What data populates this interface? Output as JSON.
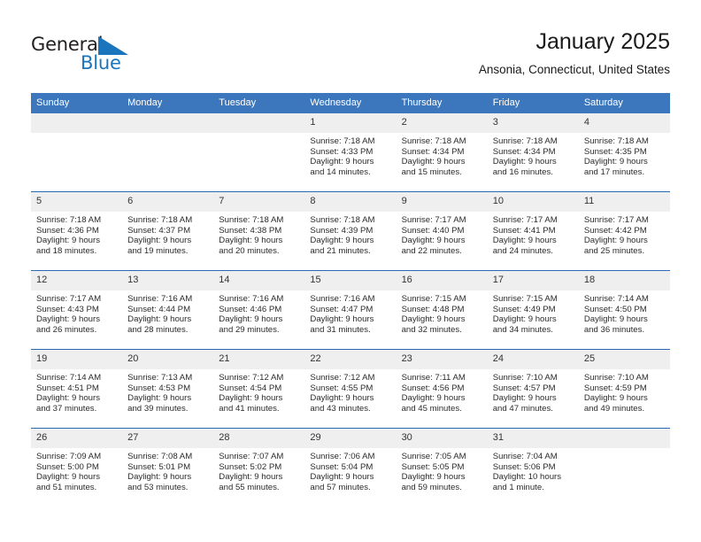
{
  "logo": {
    "word_one": "General",
    "word_two": "Blue",
    "triangle_color": "#1b75bc",
    "text_color": "#231f20"
  },
  "header": {
    "title": "January 2025",
    "subtitle": "Ansonia, Connecticut, United States"
  },
  "theme": {
    "header_blue": "#3c77bd",
    "row_divider_blue": "#2a6ab0",
    "daynum_background": "#efefef"
  },
  "weekday_headers": [
    "Sunday",
    "Monday",
    "Tuesday",
    "Wednesday",
    "Thursday",
    "Friday",
    "Saturday"
  ],
  "weeks": [
    [
      {
        "day": "",
        "lines": []
      },
      {
        "day": "",
        "lines": []
      },
      {
        "day": "",
        "lines": []
      },
      {
        "day": "1",
        "lines": [
          "Sunrise: 7:18 AM",
          "Sunset: 4:33 PM",
          "Daylight: 9 hours",
          "and 14 minutes."
        ]
      },
      {
        "day": "2",
        "lines": [
          "Sunrise: 7:18 AM",
          "Sunset: 4:34 PM",
          "Daylight: 9 hours",
          "and 15 minutes."
        ]
      },
      {
        "day": "3",
        "lines": [
          "Sunrise: 7:18 AM",
          "Sunset: 4:34 PM",
          "Daylight: 9 hours",
          "and 16 minutes."
        ]
      },
      {
        "day": "4",
        "lines": [
          "Sunrise: 7:18 AM",
          "Sunset: 4:35 PM",
          "Daylight: 9 hours",
          "and 17 minutes."
        ]
      }
    ],
    [
      {
        "day": "5",
        "lines": [
          "Sunrise: 7:18 AM",
          "Sunset: 4:36 PM",
          "Daylight: 9 hours",
          "and 18 minutes."
        ]
      },
      {
        "day": "6",
        "lines": [
          "Sunrise: 7:18 AM",
          "Sunset: 4:37 PM",
          "Daylight: 9 hours",
          "and 19 minutes."
        ]
      },
      {
        "day": "7",
        "lines": [
          "Sunrise: 7:18 AM",
          "Sunset: 4:38 PM",
          "Daylight: 9 hours",
          "and 20 minutes."
        ]
      },
      {
        "day": "8",
        "lines": [
          "Sunrise: 7:18 AM",
          "Sunset: 4:39 PM",
          "Daylight: 9 hours",
          "and 21 minutes."
        ]
      },
      {
        "day": "9",
        "lines": [
          "Sunrise: 7:17 AM",
          "Sunset: 4:40 PM",
          "Daylight: 9 hours",
          "and 22 minutes."
        ]
      },
      {
        "day": "10",
        "lines": [
          "Sunrise: 7:17 AM",
          "Sunset: 4:41 PM",
          "Daylight: 9 hours",
          "and 24 minutes."
        ]
      },
      {
        "day": "11",
        "lines": [
          "Sunrise: 7:17 AM",
          "Sunset: 4:42 PM",
          "Daylight: 9 hours",
          "and 25 minutes."
        ]
      }
    ],
    [
      {
        "day": "12",
        "lines": [
          "Sunrise: 7:17 AM",
          "Sunset: 4:43 PM",
          "Daylight: 9 hours",
          "and 26 minutes."
        ]
      },
      {
        "day": "13",
        "lines": [
          "Sunrise: 7:16 AM",
          "Sunset: 4:44 PM",
          "Daylight: 9 hours",
          "and 28 minutes."
        ]
      },
      {
        "day": "14",
        "lines": [
          "Sunrise: 7:16 AM",
          "Sunset: 4:46 PM",
          "Daylight: 9 hours",
          "and 29 minutes."
        ]
      },
      {
        "day": "15",
        "lines": [
          "Sunrise: 7:16 AM",
          "Sunset: 4:47 PM",
          "Daylight: 9 hours",
          "and 31 minutes."
        ]
      },
      {
        "day": "16",
        "lines": [
          "Sunrise: 7:15 AM",
          "Sunset: 4:48 PM",
          "Daylight: 9 hours",
          "and 32 minutes."
        ]
      },
      {
        "day": "17",
        "lines": [
          "Sunrise: 7:15 AM",
          "Sunset: 4:49 PM",
          "Daylight: 9 hours",
          "and 34 minutes."
        ]
      },
      {
        "day": "18",
        "lines": [
          "Sunrise: 7:14 AM",
          "Sunset: 4:50 PM",
          "Daylight: 9 hours",
          "and 36 minutes."
        ]
      }
    ],
    [
      {
        "day": "19",
        "lines": [
          "Sunrise: 7:14 AM",
          "Sunset: 4:51 PM",
          "Daylight: 9 hours",
          "and 37 minutes."
        ]
      },
      {
        "day": "20",
        "lines": [
          "Sunrise: 7:13 AM",
          "Sunset: 4:53 PM",
          "Daylight: 9 hours",
          "and 39 minutes."
        ]
      },
      {
        "day": "21",
        "lines": [
          "Sunrise: 7:12 AM",
          "Sunset: 4:54 PM",
          "Daylight: 9 hours",
          "and 41 minutes."
        ]
      },
      {
        "day": "22",
        "lines": [
          "Sunrise: 7:12 AM",
          "Sunset: 4:55 PM",
          "Daylight: 9 hours",
          "and 43 minutes."
        ]
      },
      {
        "day": "23",
        "lines": [
          "Sunrise: 7:11 AM",
          "Sunset: 4:56 PM",
          "Daylight: 9 hours",
          "and 45 minutes."
        ]
      },
      {
        "day": "24",
        "lines": [
          "Sunrise: 7:10 AM",
          "Sunset: 4:57 PM",
          "Daylight: 9 hours",
          "and 47 minutes."
        ]
      },
      {
        "day": "25",
        "lines": [
          "Sunrise: 7:10 AM",
          "Sunset: 4:59 PM",
          "Daylight: 9 hours",
          "and 49 minutes."
        ]
      }
    ],
    [
      {
        "day": "26",
        "lines": [
          "Sunrise: 7:09 AM",
          "Sunset: 5:00 PM",
          "Daylight: 9 hours",
          "and 51 minutes."
        ]
      },
      {
        "day": "27",
        "lines": [
          "Sunrise: 7:08 AM",
          "Sunset: 5:01 PM",
          "Daylight: 9 hours",
          "and 53 minutes."
        ]
      },
      {
        "day": "28",
        "lines": [
          "Sunrise: 7:07 AM",
          "Sunset: 5:02 PM",
          "Daylight: 9 hours",
          "and 55 minutes."
        ]
      },
      {
        "day": "29",
        "lines": [
          "Sunrise: 7:06 AM",
          "Sunset: 5:04 PM",
          "Daylight: 9 hours",
          "and 57 minutes."
        ]
      },
      {
        "day": "30",
        "lines": [
          "Sunrise: 7:05 AM",
          "Sunset: 5:05 PM",
          "Daylight: 9 hours",
          "and 59 minutes."
        ]
      },
      {
        "day": "31",
        "lines": [
          "Sunrise: 7:04 AM",
          "Sunset: 5:06 PM",
          "Daylight: 10 hours",
          "and 1 minute."
        ]
      },
      {
        "day": "",
        "lines": []
      }
    ]
  ]
}
